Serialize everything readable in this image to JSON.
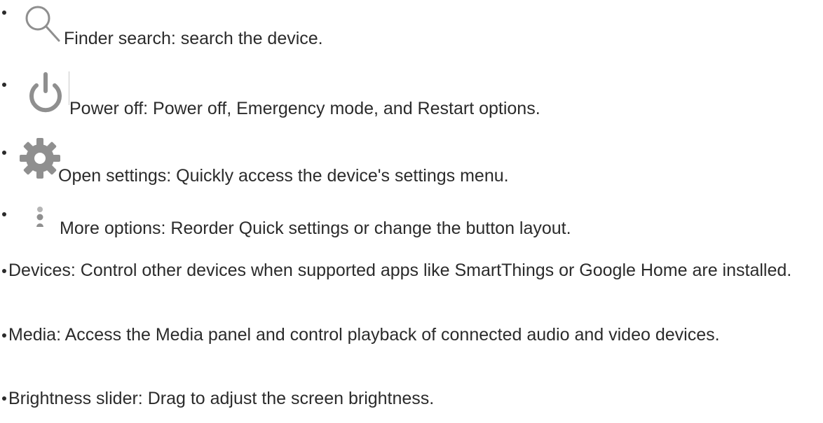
{
  "items": [
    {
      "icon": "search-icon",
      "text": "Finder search: search the device."
    },
    {
      "icon": "power-icon",
      "text": "Power off: Power off, Emergency mode, and Restart options."
    },
    {
      "icon": "gear-icon",
      "text": "Open settings: Quickly access the device's settings menu."
    },
    {
      "icon": "more-options-icon",
      "text": "More options: Reorder Quick settings or change the button layout."
    },
    {
      "text": "Devices: Control other devices when supported apps like SmartThings or Google Home are installed."
    },
    {
      "text": "Media: Access the Media panel and control playback of connected audio and video devices."
    },
    {
      "text": "Brightness slider: Drag to adjust the screen brightness."
    }
  ],
  "colors": {
    "text": "#2b2b2b",
    "icon": "#8f8f8f"
  }
}
